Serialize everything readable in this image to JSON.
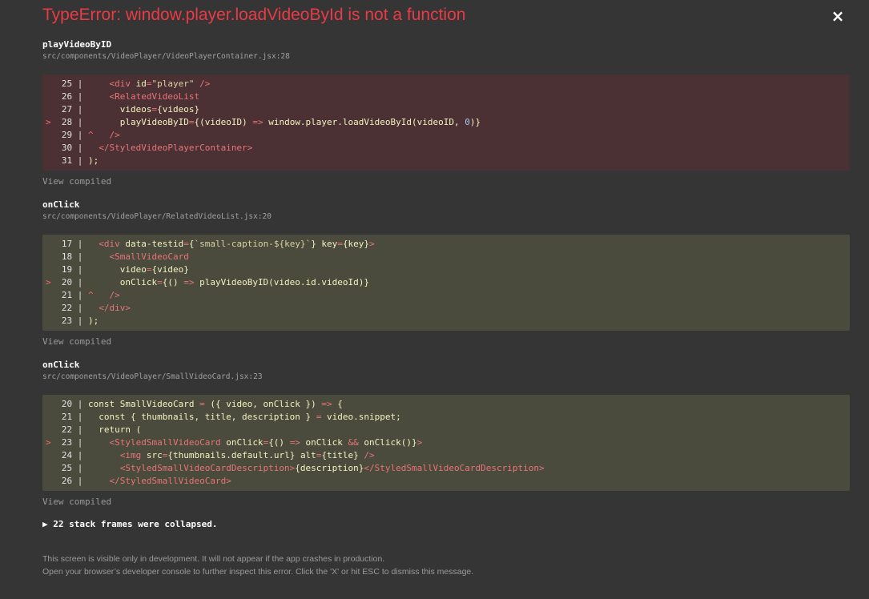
{
  "error_title": "TypeError: window.player.loadVideoById is not a function",
  "close_glyph": "×",
  "frames": [
    {
      "function": "playVideoByID",
      "file": "src/components/VideoPlayer/VideoPlayerContainer.jsx:28",
      "variant": "err",
      "lines": [
        {
          "prefix": "  ",
          "num": "25",
          "code": "    <div id=\"player\" />"
        },
        {
          "prefix": "  ",
          "num": "26",
          "code": "    <RelatedVideoList"
        },
        {
          "prefix": "  ",
          "num": "27",
          "code": "      videos={videos}"
        },
        {
          "prefix": "> ",
          "num": "28",
          "code": "      playVideoByID={(videoID) => window.player.loadVideoById(videoID, 0)}"
        },
        {
          "prefix": "  ",
          "num": "29",
          "code": "^   />"
        },
        {
          "prefix": "  ",
          "num": "30",
          "code": "  </StyledVideoPlayerContainer>"
        },
        {
          "prefix": "  ",
          "num": "31",
          "code": ");"
        }
      ],
      "view_compiled": "View compiled"
    },
    {
      "function": "onClick",
      "file": "src/components/VideoPlayer/RelatedVideoList.jsx:20",
      "variant": "ok",
      "lines": [
        {
          "prefix": "  ",
          "num": "17",
          "code": "  <div data-testid={`small-caption-${key}`} key={key}>"
        },
        {
          "prefix": "  ",
          "num": "18",
          "code": "    <SmallVideoCard"
        },
        {
          "prefix": "  ",
          "num": "19",
          "code": "      video={video}"
        },
        {
          "prefix": "> ",
          "num": "20",
          "code": "      onClick={() => playVideoByID(video.id.videoId)}"
        },
        {
          "prefix": "  ",
          "num": "21",
          "code": "^   />"
        },
        {
          "prefix": "  ",
          "num": "22",
          "code": "  </div>"
        },
        {
          "prefix": "  ",
          "num": "23",
          "code": ");"
        }
      ],
      "view_compiled": "View compiled"
    },
    {
      "function": "onClick",
      "file": "src/components/VideoPlayer/SmallVideoCard.jsx:23",
      "variant": "ok",
      "lines": [
        {
          "prefix": "  ",
          "num": "20",
          "code": "const SmallVideoCard = ({ video, onClick }) => {"
        },
        {
          "prefix": "  ",
          "num": "21",
          "code": "  const { thumbnails, title, description } = video.snippet;"
        },
        {
          "prefix": "  ",
          "num": "22",
          "code": "  return ("
        },
        {
          "prefix": "> ",
          "num": "23",
          "code": "    <StyledSmallVideoCard onClick={() => onClick && onClick()}>"
        },
        {
          "prefix": "  ",
          "num": "24",
          "code": "      <img src={thumbnails.default.url} alt={title} />"
        },
        {
          "prefix": "  ",
          "num": "25",
          "code": "      <StyledSmallVideoCardDescription>{description}</StyledSmallVideoCardDescription>"
        },
        {
          "prefix": "  ",
          "num": "26",
          "code": "    </StyledSmallVideoCard>"
        }
      ],
      "view_compiled": "View compiled"
    }
  ],
  "collapsed_text": "▶ 22 stack frames were collapsed.",
  "footer_line1": "This screen is visible only in development. It will not appear if the app crashes in production.",
  "footer_line2": "Open your browser’s developer console to further inspect this error.  Click the 'X' or hit ESC to dismiss this message."
}
